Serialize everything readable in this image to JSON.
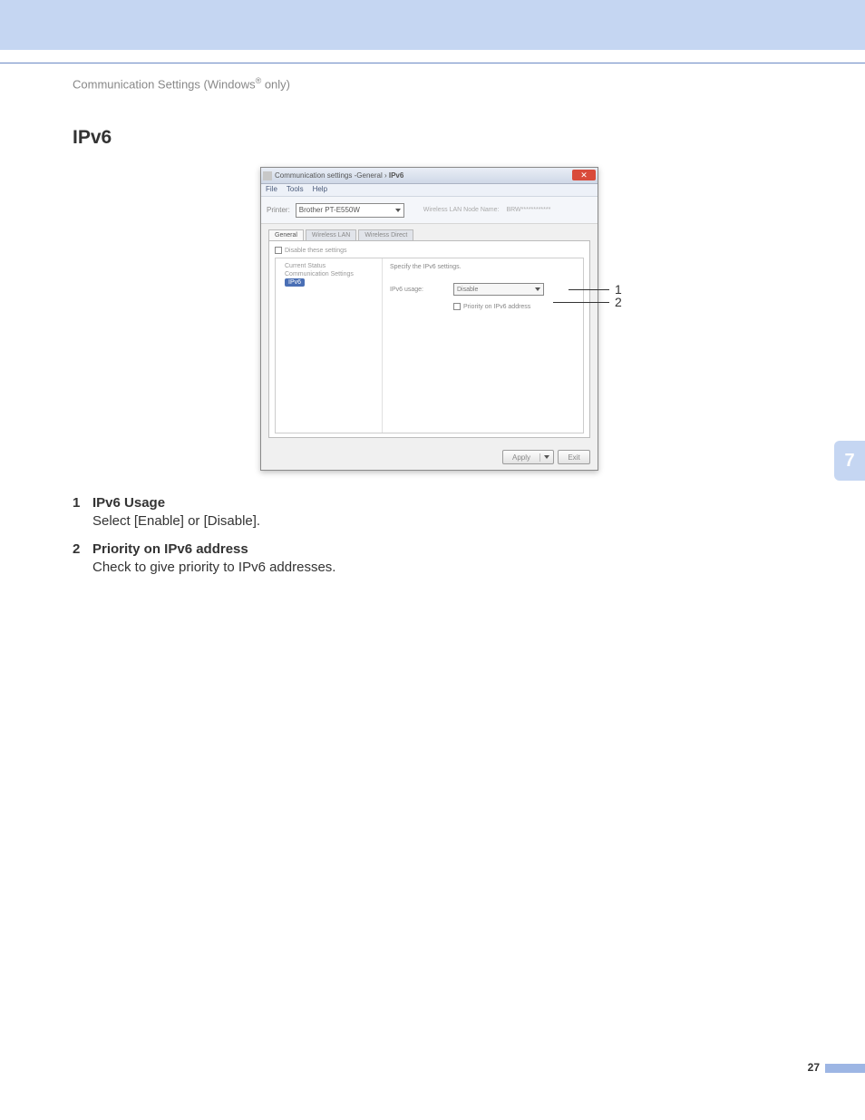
{
  "breadcrumb": {
    "text_pre": "Communication Settings (Windows",
    "reg": "®",
    "text_post": " only)"
  },
  "section_title": "IPv6",
  "dialog": {
    "title_prefix": "Communication settings - ",
    "title_path": "General",
    "title_leaf": "IPv6",
    "menu": {
      "file": "File",
      "tools": "Tools",
      "help": "Help"
    },
    "printer_label": "Printer:",
    "printer_value": "Brother PT-E550W",
    "node_name_label": "Wireless LAN Node Name:",
    "node_name_value": "BRW************",
    "tabs": {
      "general": "General",
      "wlan": "Wireless LAN",
      "wdirect": "Wireless Direct"
    },
    "disable_these": "Disable these settings",
    "tree": {
      "current_status": "Current Status",
      "comm_settings": "Communication Settings",
      "ipv6": "IPv6"
    },
    "right": {
      "desc": "Specify the IPv6 settings.",
      "usage_label": "IPv6 usage:",
      "usage_value": "Disable",
      "priority_label": "Priority on IPv6 address"
    },
    "buttons": {
      "apply": "Apply",
      "exit": "Exit"
    }
  },
  "callouts": {
    "c1": "1",
    "c2": "2"
  },
  "descriptions": {
    "d1_term": "IPv6 Usage",
    "d1_body": "Select [Enable] or [Disable].",
    "d2_term": "Priority on IPv6 address",
    "d2_body": "Check to give priority to IPv6 addresses."
  },
  "chapter_number": "7",
  "page_number": "27"
}
